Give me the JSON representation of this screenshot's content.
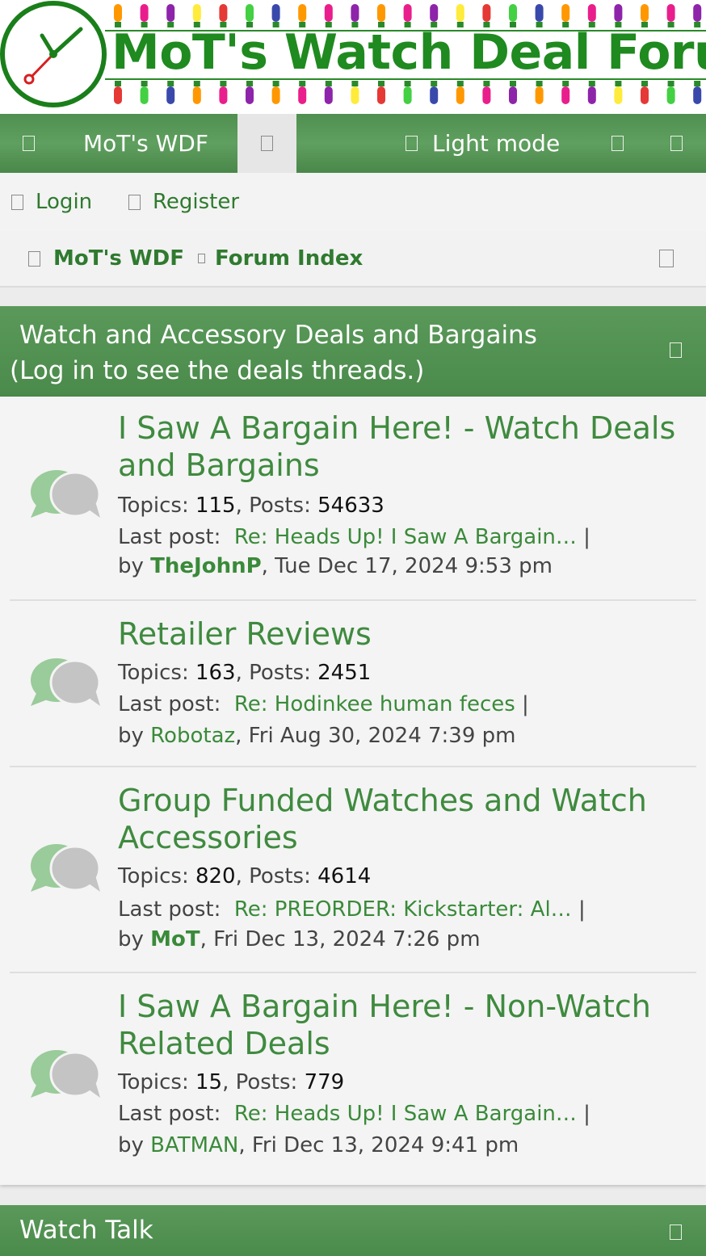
{
  "site": {
    "title": "MoT's Watch Deal Forum",
    "colors": {
      "brand_green": "#1f8a1f",
      "nav_green": "#4f8f4f",
      "link_green": "#3a8a3a"
    }
  },
  "nav": {
    "menu_icon": "bars-icon",
    "home_label": "MoT's WDF",
    "search_icon": "search-icon",
    "light_mode_label": "Light mode",
    "light_mode_icon": "sun-icon",
    "extra_icons": [
      "bell-icon",
      "envelope-icon"
    ]
  },
  "auth": {
    "login_label": "Login",
    "register_label": "Register"
  },
  "breadcrumb": {
    "home_label": "MoT's WDF",
    "separator_icon": "chevron-right-icon",
    "index_label": "Forum Index",
    "right_icon": "search-icon"
  },
  "categories": [
    {
      "title_line1": "Watch and Accessory Deals and Bargains",
      "title_line2": "(Log in to see the deals threads.)",
      "forums": [
        {
          "title": "I Saw A Bargain Here! - Watch Deals and Bargains",
          "topics_label": "Topics:",
          "topics": "115",
          "posts_label": "Posts:",
          "posts": "54633",
          "last_post_label": "Last post:",
          "last_post": "Re: Heads Up! I Saw A Bargain…",
          "by_label": "by",
          "author": "TheJohnP",
          "date": ", Tue Dec 17, 2024 9:53 pm"
        },
        {
          "title": "Retailer Reviews",
          "topics_label": "Topics:",
          "topics": "163",
          "posts_label": "Posts:",
          "posts": "2451",
          "last_post_label": "Last post:",
          "last_post": "Re: Hodinkee human feces",
          "by_label": "by",
          "author": "Robotaz",
          "date": ", Fri Aug 30, 2024 7:39 pm"
        },
        {
          "title": "Group Funded Watches and Watch Accessories",
          "topics_label": "Topics:",
          "topics": "820",
          "posts_label": "Posts:",
          "posts": "4614",
          "last_post_label": "Last post:",
          "last_post": "Re: PREORDER: Kickstarter: Al…",
          "by_label": "by",
          "author": "MoT",
          "date": ", Fri Dec 13, 2024 7:26 pm"
        },
        {
          "title": "I Saw A Bargain Here! - Non-Watch Related Deals",
          "topics_label": "Topics:",
          "topics": "15",
          "posts_label": "Posts:",
          "posts": "779",
          "last_post_label": "Last post:",
          "last_post": "Re: Heads Up! I Saw A Bargain…",
          "by_label": "by",
          "author": "BATMAN",
          "date": ", Fri Dec 13, 2024 9:41 pm"
        }
      ]
    },
    {
      "title_line1": "Watch Talk"
    }
  ]
}
